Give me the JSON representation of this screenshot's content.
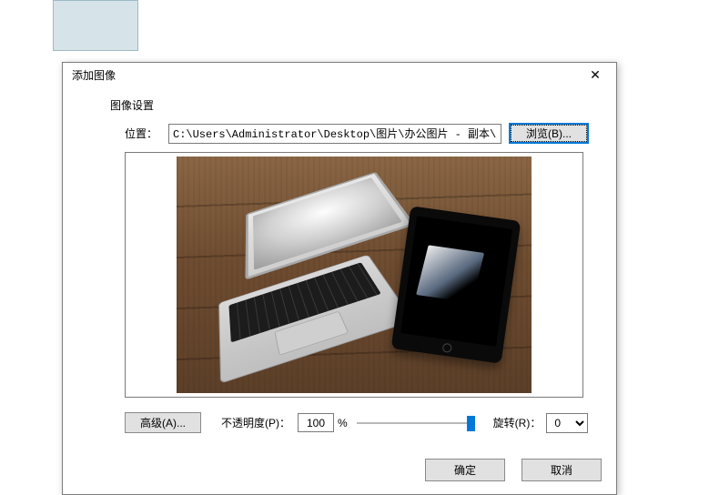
{
  "dialog": {
    "title": "添加图像",
    "section_label": "图像设置",
    "close_glyph": "✕"
  },
  "location": {
    "label": "位置：",
    "path": "C:\\Users\\Administrator\\Desktop\\图片\\办公图片 - 副本\\办公图",
    "browse_label": "浏览(B)..."
  },
  "controls": {
    "advanced_label": "高级(A)...",
    "opacity_label": "不透明度(P)：",
    "opacity_value": "100",
    "percent": "%",
    "rotate_label": "旋转(R)：",
    "rotate_value": "0"
  },
  "footer": {
    "ok": "确定",
    "cancel": "取消"
  }
}
